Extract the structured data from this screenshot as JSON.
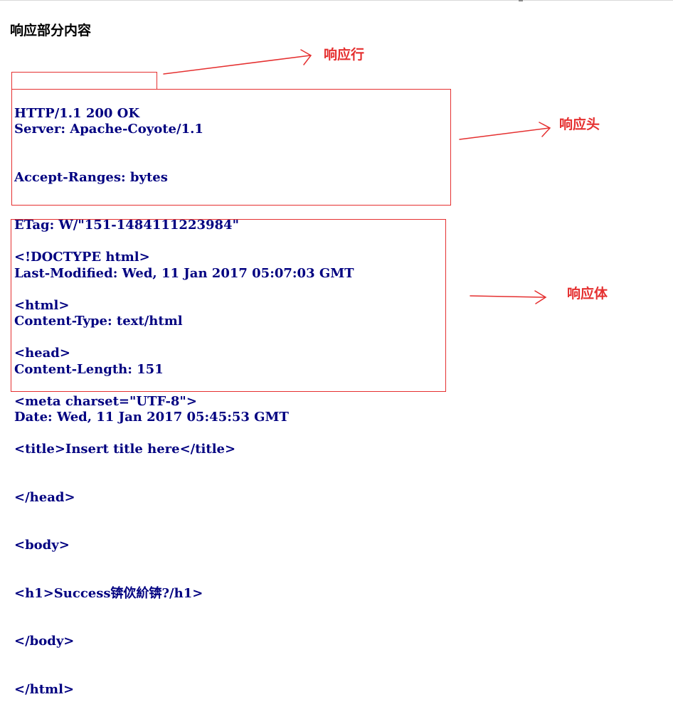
{
  "title": "响应部分内容",
  "status_line": "HTTP/1.1 200 OK",
  "headers": [
    "Server: Apache-Coyote/1.1",
    "Accept-Ranges: bytes",
    "ETag: W/\"151-1484111223984\"",
    "Last-Modified: Wed, 11 Jan 2017 05:07:03 GMT",
    "Content-Type: text/html",
    "Content-Length: 151",
    "Date: Wed, 11 Jan 2017 05:45:53 GMT"
  ],
  "body_lines": [
    "<!DOCTYPE html>",
    "<html>",
    "<head>",
    "<meta charset=\"UTF-8\">",
    "<title>Insert title here</title>",
    "</head>",
    "<body>",
    "<h1>Success锛佽紒锛?/h1>",
    "</body>",
    "</html>"
  ],
  "annotations": {
    "status_line_label": "响应行",
    "headers_label": "响应头",
    "body_label": "响应体"
  },
  "colors": {
    "code_text": "#000080",
    "annotation": "#e53030"
  }
}
